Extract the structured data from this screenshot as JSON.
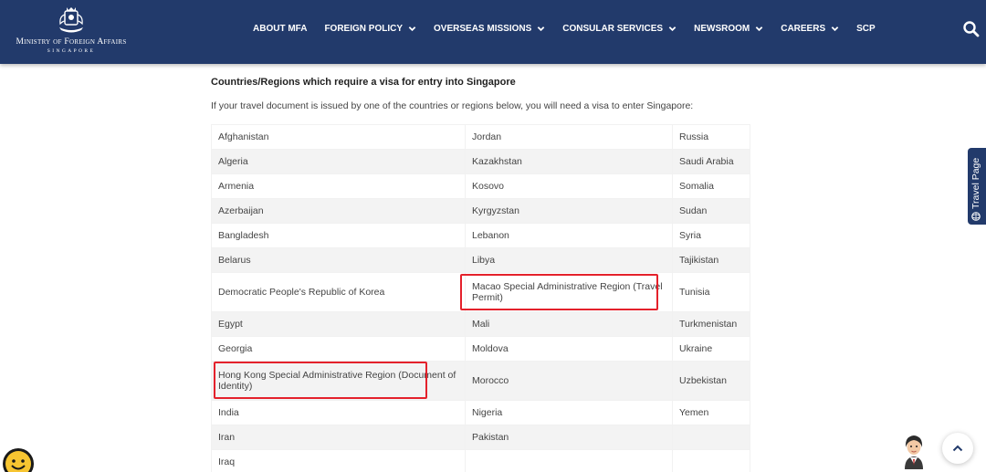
{
  "header": {
    "logo_title": "Ministry of Foreign Affairs",
    "logo_subtitle": "SINGAPORE",
    "nav": [
      {
        "label": "ABOUT MFA",
        "dropdown": false
      },
      {
        "label": "FOREIGN POLICY",
        "dropdown": true
      },
      {
        "label": "OVERSEAS MISSIONS",
        "dropdown": true
      },
      {
        "label": "CONSULAR SERVICES",
        "dropdown": true
      },
      {
        "label": "NEWSROOM",
        "dropdown": true
      },
      {
        "label": "CAREERS",
        "dropdown": true
      },
      {
        "label": "SCP",
        "dropdown": false
      }
    ],
    "search_icon": "search-icon"
  },
  "content": {
    "heading": "Countries/Regions which require a visa for entry into Singapore",
    "intro": "If your travel document is issued by one of the countries or regions below, you will need a visa to enter Singapore:",
    "rows": [
      [
        "Afghanistan",
        "Jordan",
        "Russia"
      ],
      [
        "Algeria",
        "Kazakhstan",
        "Saudi Arabia"
      ],
      [
        "Armenia",
        "Kosovo",
        "Somalia"
      ],
      [
        "Azerbaijan",
        "Kyrgyzstan",
        "Sudan"
      ],
      [
        "Bangladesh",
        "Lebanon",
        "Syria"
      ],
      [
        "Belarus",
        "Libya",
        "Tajikistan"
      ],
      [
        "Democratic People's Republic of Korea",
        "Macao Special Administrative Region (Travel Permit)",
        "Tunisia"
      ],
      [
        "Egypt",
        "Mali",
        "Turkmenistan"
      ],
      [
        "Georgia",
        "Moldova",
        "Ukraine"
      ],
      [
        "Hong Kong Special Administrative Region (Document of Identity)",
        "Morocco",
        "Uzbekistan"
      ],
      [
        "India",
        "Nigeria",
        "Yemen"
      ],
      [
        "Iran",
        "Pakistan",
        ""
      ],
      [
        "Iraq",
        "",
        ""
      ]
    ]
  },
  "widgets": {
    "travel_page_label": "Travel Page"
  },
  "colors": {
    "header_bg": "#223a6b",
    "highlight_border": "#e4212b",
    "stripe_bg": "#f3f3f3"
  }
}
